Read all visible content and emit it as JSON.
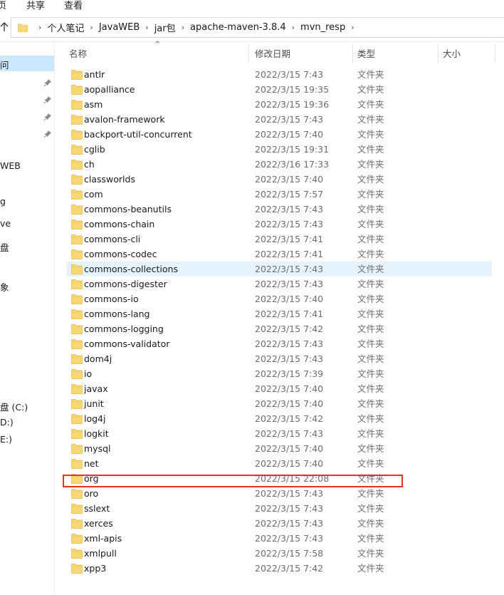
{
  "ribbon": {
    "tabs": [
      "页",
      "共享",
      "查看"
    ]
  },
  "address": {
    "crumbs": [
      "个人笔记",
      "JavaWEB",
      "jar包",
      "apache-maven-3.8.4",
      "mvn_resp"
    ]
  },
  "nav": {
    "items": [
      {
        "label": "问",
        "selected": true
      },
      {
        "label": "WEB"
      },
      {
        "label": "g"
      },
      {
        "label": "ve"
      },
      {
        "label": "盘"
      },
      {
        "label": "象"
      },
      {
        "label": "盘 (C:)"
      },
      {
        "label": "D:)"
      },
      {
        "label": "E:)"
      }
    ]
  },
  "columns": {
    "name": "名称",
    "date": "修改日期",
    "type": "类型",
    "size": "大小"
  },
  "files": [
    {
      "name": "antlr",
      "date": "2022/3/15 7:43",
      "type": "文件夹"
    },
    {
      "name": "aopalliance",
      "date": "2022/3/15 19:35",
      "type": "文件夹"
    },
    {
      "name": "asm",
      "date": "2022/3/15 19:36",
      "type": "文件夹"
    },
    {
      "name": "avalon-framework",
      "date": "2022/3/15 7:43",
      "type": "文件夹"
    },
    {
      "name": "backport-util-concurrent",
      "date": "2022/3/15 7:40",
      "type": "文件夹"
    },
    {
      "name": "cglib",
      "date": "2022/3/15 19:31",
      "type": "文件夹"
    },
    {
      "name": "ch",
      "date": "2022/3/16 17:33",
      "type": "文件夹"
    },
    {
      "name": "classworlds",
      "date": "2022/3/15 7:40",
      "type": "文件夹"
    },
    {
      "name": "com",
      "date": "2022/3/15 7:57",
      "type": "文件夹"
    },
    {
      "name": "commons-beanutils",
      "date": "2022/3/15 7:43",
      "type": "文件夹"
    },
    {
      "name": "commons-chain",
      "date": "2022/3/15 7:43",
      "type": "文件夹"
    },
    {
      "name": "commons-cli",
      "date": "2022/3/15 7:41",
      "type": "文件夹"
    },
    {
      "name": "commons-codec",
      "date": "2022/3/15 7:41",
      "type": "文件夹"
    },
    {
      "name": "commons-collections",
      "date": "2022/3/15 7:43",
      "type": "文件夹"
    },
    {
      "name": "commons-digester",
      "date": "2022/3/15 7:43",
      "type": "文件夹"
    },
    {
      "name": "commons-io",
      "date": "2022/3/15 7:40",
      "type": "文件夹"
    },
    {
      "name": "commons-lang",
      "date": "2022/3/15 7:41",
      "type": "文件夹"
    },
    {
      "name": "commons-logging",
      "date": "2022/3/15 7:42",
      "type": "文件夹"
    },
    {
      "name": "commons-validator",
      "date": "2022/3/15 7:43",
      "type": "文件夹"
    },
    {
      "name": "dom4j",
      "date": "2022/3/15 7:43",
      "type": "文件夹"
    },
    {
      "name": "io",
      "date": "2022/3/15 7:39",
      "type": "文件夹"
    },
    {
      "name": "javax",
      "date": "2022/3/15 7:40",
      "type": "文件夹"
    },
    {
      "name": "junit",
      "date": "2022/3/15 7:40",
      "type": "文件夹"
    },
    {
      "name": "log4j",
      "date": "2022/3/15 7:42",
      "type": "文件夹"
    },
    {
      "name": "logkit",
      "date": "2022/3/15 7:43",
      "type": "文件夹"
    },
    {
      "name": "mysql",
      "date": "2022/3/15 7:40",
      "type": "文件夹"
    },
    {
      "name": "net",
      "date": "2022/3/15 7:40",
      "type": "文件夹"
    },
    {
      "name": "org",
      "date": "2022/3/15 22:08",
      "type": "文件夹"
    },
    {
      "name": "oro",
      "date": "2022/3/15 7:43",
      "type": "文件夹"
    },
    {
      "name": "sslext",
      "date": "2022/3/15 7:43",
      "type": "文件夹"
    },
    {
      "name": "xerces",
      "date": "2022/3/15 7:43",
      "type": "文件夹"
    },
    {
      "name": "xml-apis",
      "date": "2022/3/15 7:43",
      "type": "文件夹"
    },
    {
      "name": "xmlpull",
      "date": "2022/3/15 7:58",
      "type": "文件夹"
    },
    {
      "name": "xpp3",
      "date": "2022/3/15 7:42",
      "type": "文件夹"
    }
  ],
  "hover_index": 13,
  "highlight_index": 27,
  "colors": {
    "selection": "#cce8ff",
    "hover": "#e5f3ff",
    "folder": "#f8d775",
    "annotation": "#e8341c"
  }
}
